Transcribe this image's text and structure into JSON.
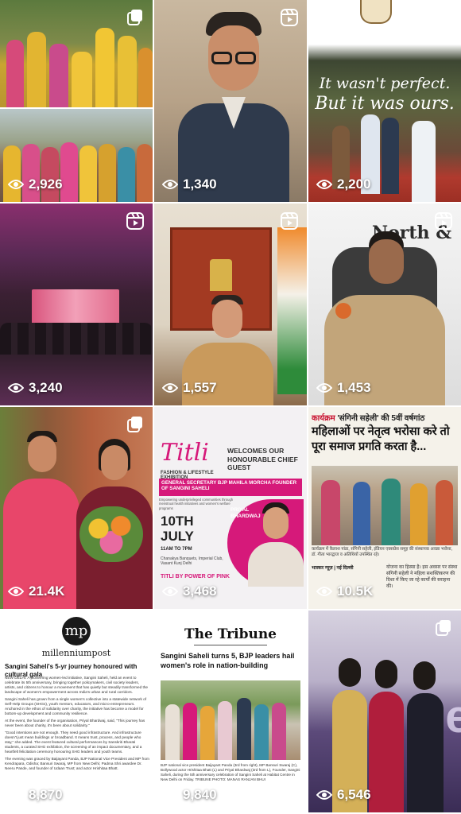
{
  "tiles": [
    {
      "views": "2,926",
      "badge": "carousel-icon"
    },
    {
      "views": "1,340",
      "badge": "reel-icon"
    },
    {
      "views": "2,200",
      "badge": "reel-icon",
      "overlay_line1": "It wasn't perfect.",
      "overlay_line2": "But it was ours."
    },
    {
      "views": "3,240",
      "badge": "reel-icon"
    },
    {
      "views": "1,557",
      "badge": "reel-icon"
    },
    {
      "views": "1,453",
      "badge": "reel-icon",
      "sign_text": "North &"
    },
    {
      "views": "21.4K",
      "badge": "carousel-icon"
    },
    {
      "views": "3,468",
      "badge": "none",
      "brand": "Titli",
      "brand_sub": "FASHION & LIFESTYLE EXHIBITION",
      "headline": "WELCOMES OUR HONOURABLE CHIEF GUEST",
      "role": "GENERAL SECRETARY BJP MAHILA MORCHA FOUNDER OF SANGINI SAHELI",
      "role_sub": "Empowering underprivileged communities through menstrual health initiatives and women's welfare programs",
      "date": "10TH",
      "month": "JULY",
      "time": "11AM TO 7PM",
      "venue": "Chanakya Banquets, Imperial Club, Vasant Kunj Delhi",
      "guest": "PRIYAL BHARDWAJ",
      "footer": "TITLI BY POWER OF PINK"
    },
    {
      "views": "10.5K",
      "badge": "none",
      "kicker": "कार्यक्रम",
      "kicker_rest": "'संगिनी सहेली' की 5वीं वर्षगांठ",
      "headline": "महिलाओं पर नेतृत्व भरोसा करे तो पूरा समाज प्रगति करता है...",
      "caption": "कार्यक्रम में कैलाश पांडा, संगिनी सहेली, इंडियन एक्सप्रेस समूह की संस्थापक अवन्ना भरोसा, डॉ. गीता भारद्वाज व अतिथियों उपस्थित रहे।",
      "col_head": "भास्कर न्यूज़ | नई दिल्ली",
      "col_body": "योजना का हिस्सा है। इस अवसर पर संस्था संगिनी सहेली ने महिला सशक्तिकरण की दिशा में किए जा रहे कार्यों की सराहना की।"
    },
    {
      "views": "8,870",
      "badge": "none",
      "brand_mark": "mp",
      "brand": "millenniumpost",
      "headline": "Sangini Saheli's 5-yr journey honoured with cultural gala",
      "body1": "NEW DELHI: A pioneering women-led initiative, Sangini Saheli, held an event to celebrate its 5th anniversary, bringing together policymakers, civil society leaders, artists, and citizens to honour a movement that has quietly but steadily transformed the landscape of women's empowerment across India's urban and rural corridors.",
      "body2": "Sangini Saheli has grown from a single women's collective into a statewide network of Self-Help Groups (SHGs), youth mentors, educators, and micro-entrepreneurs. Anchored in the ethos of solidarity over charity, the initiative has become a model for bottom-up development and community resilience.",
      "body3": "At the event, the founder of the organisation, Priyal Bhardwaj, said, \"This journey has never been about charity, it's been about solidarity.\"",
      "body4": "\"Good intentions are not enough. They need good infrastructure. And infrastructure doesn't just mean buildings or broadband. It means trust, process, and people who stay,\" she added. The event featured cultural performances by Sanskriti Bharati students, a curated SHG exhibition, the screening of an impact documentary, and a heartfelt felicitation ceremony honouring SHG leaders and youth teams.",
      "body5": "The evening was graced by Baijayant Panda, BJP National Vice President and MP from Kendrapara, Odisha; Bansuri Swaraj, MP from New Delhi; Padma Shri awardee Dr. Neeru Pande, and founder of Udaan Trust; and actor Hrishitaa Bhatt."
    },
    {
      "views": "9,840",
      "badge": "none",
      "brand": "The Tribune",
      "headline": "Sangini Saheli turns 5, BJP leaders hail women's role in nation-building",
      "caption": "BJP national vice president Baijayant Panda (3rd from right), MP Bansuri Swaraj (C), Bollywood actor Hrishitaa Bhatt (L) and Priyal Bhardwaj (3rd from L), Founder, Sangini Saheli, during the 5th anniversary celebration of Sangini Saheli at Habitat Centre in New Delhi on Friday. TRIBUNE PHOTO: MANAS RANJAN BHUI"
    },
    {
      "views": "6,546",
      "badge": "carousel-icon",
      "banner": "se"
    }
  ],
  "colors": {
    "view_text": "#ffffff",
    "pink": "#d6197a",
    "red": "#c8102e"
  }
}
